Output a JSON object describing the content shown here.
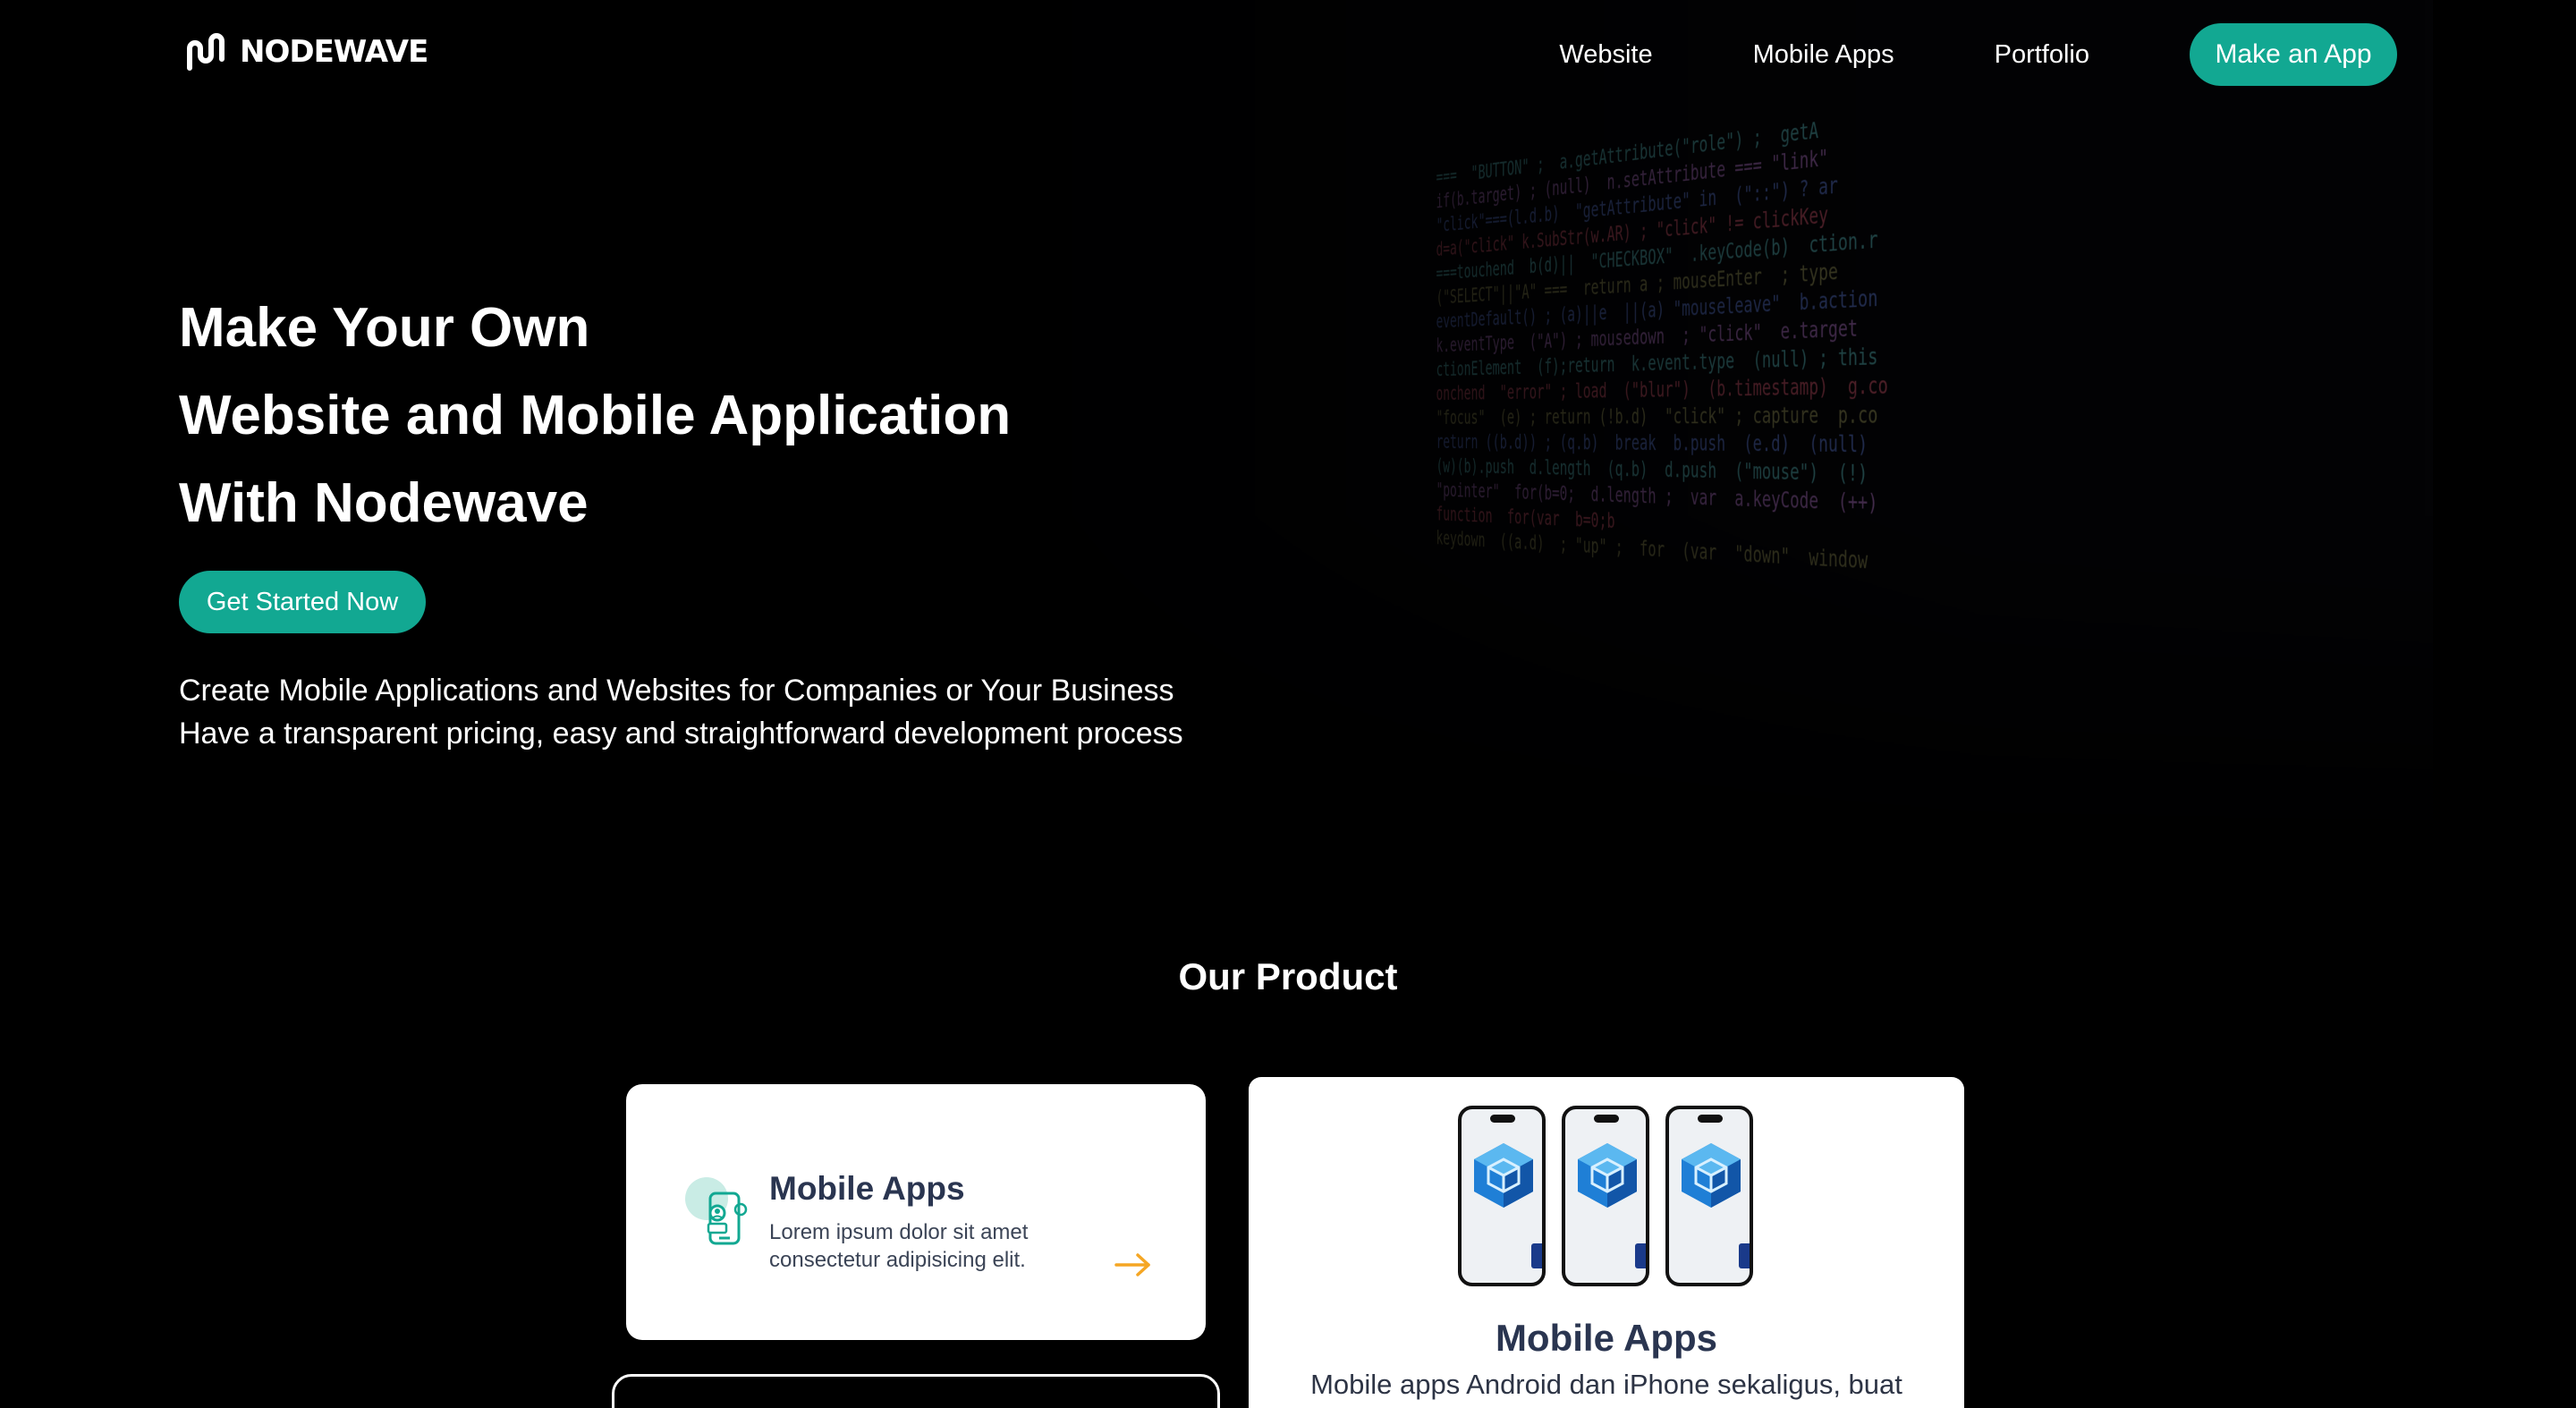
{
  "brand": {
    "name": "NODEWAVE",
    "accent": "#12a892"
  },
  "nav": {
    "items": [
      "Website",
      "Mobile Apps",
      "Portfolio"
    ],
    "cta": "Make an App"
  },
  "hero": {
    "title_lines": [
      "Make Your Own",
      "Website and Mobile Application",
      "With Nodewave"
    ],
    "button": "Get Started Now",
    "subtitle_lines": [
      "Create Mobile Applications and Websites for Companies or Your Business",
      "Have a transparent pricing, easy and straightforward development process"
    ]
  },
  "products": {
    "heading": "Our Product",
    "small_card": {
      "title": "Mobile Apps",
      "description": "Lorem ipsum dolor sit amet consectetur adipisicing elit.",
      "icon": "mobile-user-icon",
      "arrow_color": "#f5a623"
    },
    "large_card": {
      "title": "Mobile Apps",
      "description": "Mobile apps Android dan iPhone sekaligus, buat"
    }
  }
}
